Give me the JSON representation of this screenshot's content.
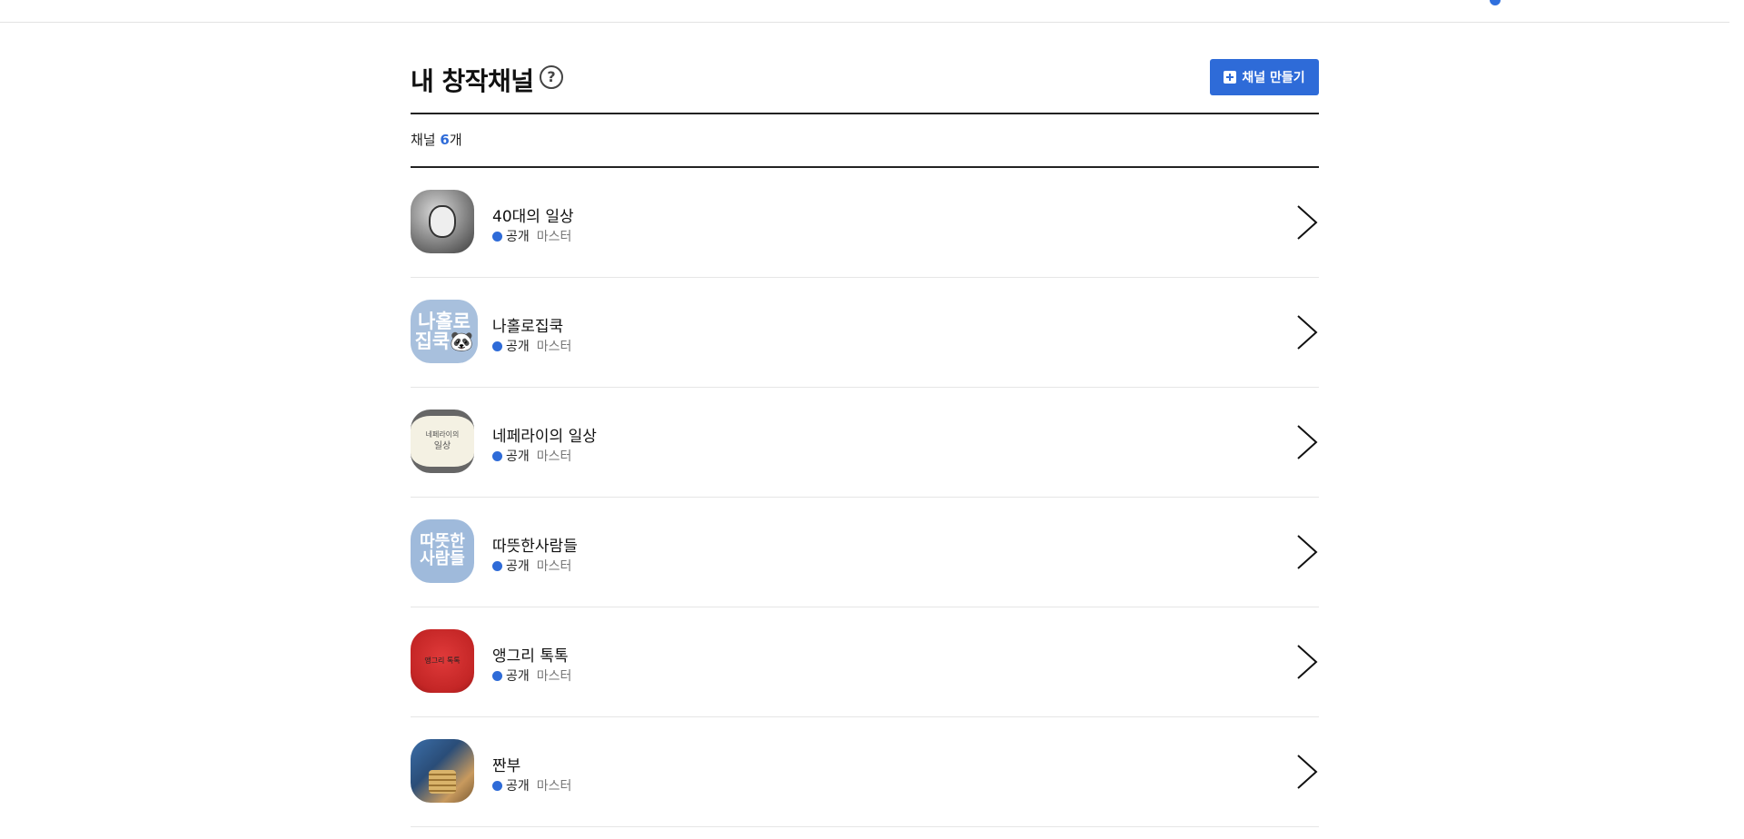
{
  "page": {
    "title": "내 창작채널",
    "create_button": "채널 만들기",
    "count_prefix": "채널 ",
    "count_value": "6",
    "count_suffix": "개",
    "accent_color": "#2e6bd8"
  },
  "channels": [
    {
      "name": "40대의 일상",
      "status": "공개",
      "role": "마스터",
      "thumb_text": ""
    },
    {
      "name": "나홀로집쿡",
      "status": "공개",
      "role": "마스터",
      "thumb_text": "나홀로 집쿡🐼"
    },
    {
      "name": "네페라이의 일상",
      "status": "공개",
      "role": "마스터",
      "thumb_text_1": "네페라이의",
      "thumb_text_2": "일상"
    },
    {
      "name": "따뜻한사람들",
      "status": "공개",
      "role": "마스터",
      "thumb_text": "따뜻한 사람들"
    },
    {
      "name": "앵그리 톡톡",
      "status": "공개",
      "role": "마스터",
      "thumb_text": "앵그리 톡톡"
    },
    {
      "name": "짠부",
      "status": "공개",
      "role": "마스터",
      "thumb_text": ""
    }
  ],
  "icons": {
    "help": "question-circle-icon",
    "create": "plus-square-icon",
    "chevron": "chevron-right-icon",
    "status_dot": "status-dot-icon"
  }
}
